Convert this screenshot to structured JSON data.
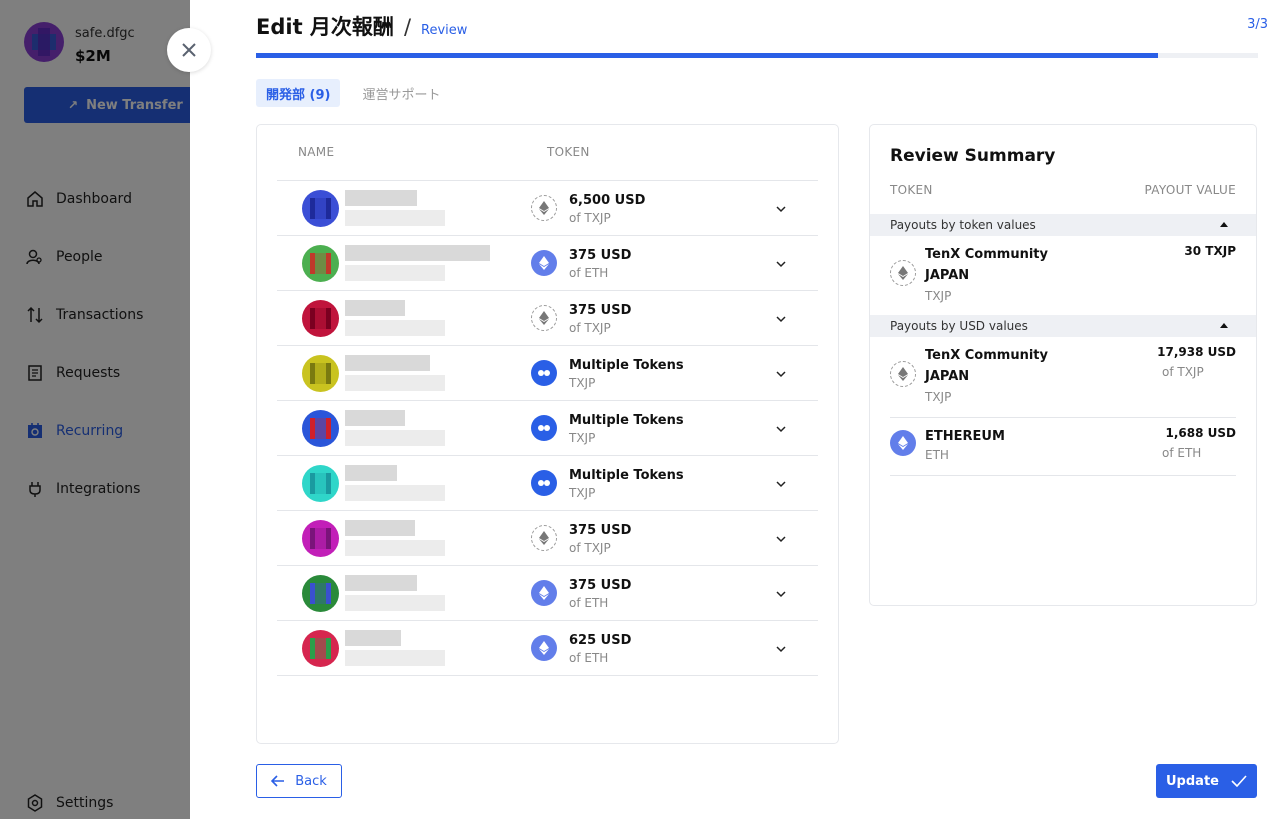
{
  "sidebar": {
    "safe_name": "safe.dfgc",
    "safe_balance": "$2M",
    "new_transfer_label": "New Transfer",
    "items": [
      {
        "label": "Dashboard",
        "icon": "home-icon"
      },
      {
        "label": "People",
        "icon": "person-search-icon"
      },
      {
        "label": "Transactions",
        "icon": "arrows-up-down-icon"
      },
      {
        "label": "Requests",
        "icon": "document-icon"
      },
      {
        "label": "Recurring",
        "icon": "calendar-repeat-icon",
        "active": true
      },
      {
        "label": "Integrations",
        "icon": "plug-icon"
      }
    ],
    "settings_label": "Settings"
  },
  "header": {
    "title": "Edit 月次報酬",
    "separator": "/",
    "step_name": "Review",
    "step_count": "3/3",
    "progress": 0.9
  },
  "tabs": [
    {
      "label": "開発部 (9)",
      "active": true
    },
    {
      "label": "運営サポート",
      "active": false
    }
  ],
  "table": {
    "columns": [
      "NAME",
      "TOKEN"
    ],
    "rows": [
      {
        "amount": "6,500 USD",
        "token": "of TXJP",
        "token_type": "txjp",
        "avatar_color": "#3b4fd6",
        "avatar_accent": "#1e2a9a"
      },
      {
        "amount": "375 USD",
        "token": "of ETH",
        "token_type": "eth",
        "avatar_color": "#4caf50",
        "avatar_accent": "#c0392b"
      },
      {
        "amount": "375 USD",
        "token": "of TXJP",
        "token_type": "txjp",
        "avatar_color": "#c0143c",
        "avatar_accent": "#7a0020"
      },
      {
        "amount": "Multiple Tokens",
        "token": "TXJP",
        "token_type": "multi",
        "avatar_color": "#c9c320",
        "avatar_accent": "#7a7a10"
      },
      {
        "amount": "Multiple Tokens",
        "token": "TXJP",
        "token_type": "multi",
        "avatar_color": "#2b56d9",
        "avatar_accent": "#d0202a"
      },
      {
        "amount": "Multiple Tokens",
        "token": "TXJP",
        "token_type": "multi",
        "avatar_color": "#2fd6c9",
        "avatar_accent": "#1a9aa0"
      },
      {
        "amount": "375 USD",
        "token": "of TXJP",
        "token_type": "txjp",
        "avatar_color": "#c21fb8",
        "avatar_accent": "#7a147a"
      },
      {
        "amount": "375 USD",
        "token": "of ETH",
        "token_type": "eth",
        "avatar_color": "#2a8a3a",
        "avatar_accent": "#3a50d0"
      },
      {
        "amount": "625 USD",
        "token": "of ETH",
        "token_type": "eth",
        "avatar_color": "#d6264f",
        "avatar_accent": "#2aa04a"
      }
    ]
  },
  "summary": {
    "title": "Review Summary",
    "col_token": "TOKEN",
    "col_payout": "PAYOUT VALUE",
    "group_token_label": "Payouts by token values",
    "group_usd_label": "Payouts by USD values",
    "token_rows": [
      {
        "name": "TenX Community JAPAN",
        "symbol": "TXJP",
        "value": "30 TXJP",
        "value_sub": ""
      }
    ],
    "usd_rows": [
      {
        "name": "TenX Community JAPAN",
        "symbol": "TXJP",
        "value": "17,938 USD",
        "value_sub": "of TXJP"
      },
      {
        "name": "ETHEREUM",
        "symbol": "ETH",
        "value": "1,688 USD",
        "value_sub": "of ETH"
      }
    ]
  },
  "footer": {
    "back_label": "Back",
    "update_label": "Update"
  },
  "colors": {
    "accent": "#2a5fe6",
    "eth": "#627eea"
  }
}
